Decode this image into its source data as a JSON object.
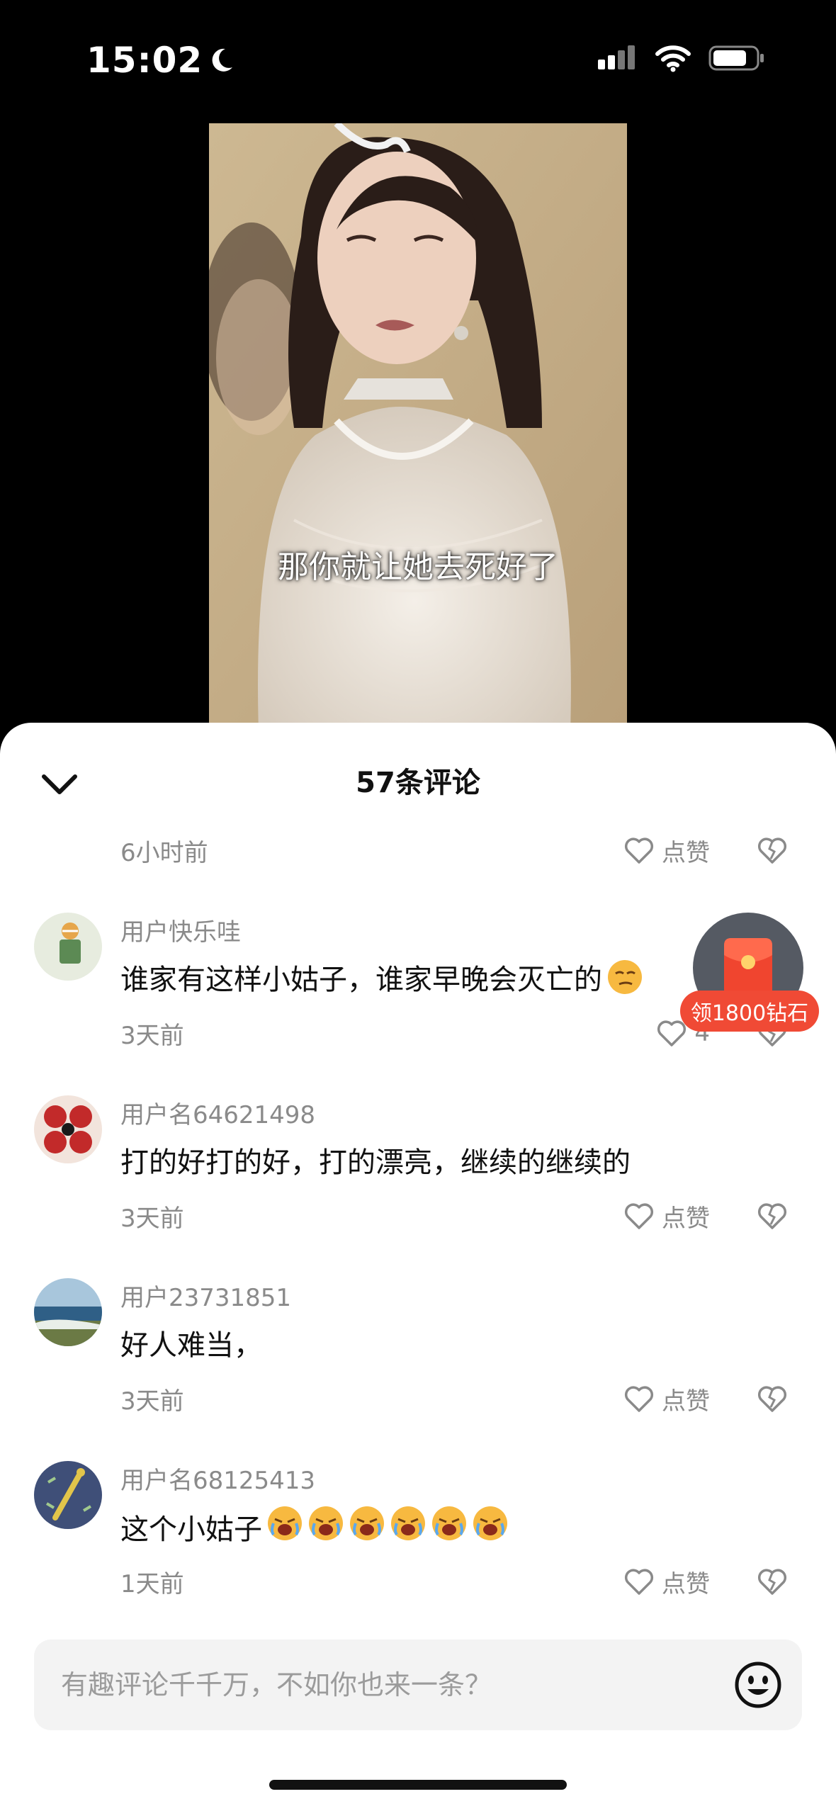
{
  "status_bar": {
    "time": "15:02"
  },
  "video": {
    "subtitle": "那你就让她去死好了"
  },
  "comments_sheet": {
    "title": "57条评论",
    "top_item": {
      "time": "6小时前",
      "like_label": "点赞"
    },
    "comments": [
      {
        "username": "用户快乐哇",
        "text": "谁家有这样小姑子，谁家早晚会灭亡的",
        "time": "3天前",
        "like_label": "4",
        "emoji": "smirk-face"
      },
      {
        "username": "用户名64621498",
        "text": "打的好打的好，打的漂亮，继续的继续的",
        "time": "3天前",
        "like_label": "点赞"
      },
      {
        "username": "用户23731851",
        "text": "好人难当，",
        "time": "3天前",
        "like_label": "点赞"
      },
      {
        "username": "用户名68125413",
        "text": "这个小姑子",
        "time": "1天前",
        "like_label": "点赞",
        "emoji_count": 6,
        "emoji": "crying-face"
      }
    ]
  },
  "red_packet": {
    "label": "领1800钻石"
  },
  "comment_input": {
    "placeholder": "有趣评论千千万，不如你也来一条？"
  },
  "colors": {
    "accent_red": "#f04a35",
    "meta_gray": "#8a8a8a"
  }
}
